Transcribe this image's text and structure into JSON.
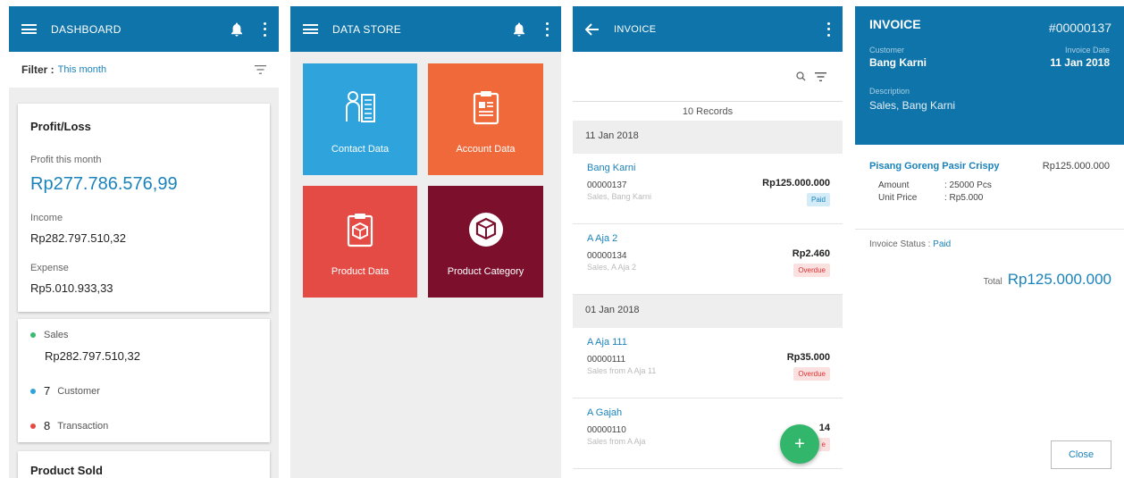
{
  "dashboard": {
    "title": "DASHBOARD",
    "filter_label": "Filter :",
    "filter_value": "This month",
    "profit_card_title": "Profit/Loss",
    "profit_label": "Profit this month",
    "profit_value": "Rp277.786.576,99",
    "income_label": "Income",
    "income_value": "Rp282.797.510,32",
    "expense_label": "Expense",
    "expense_value": "Rp5.010.933,33",
    "sales_label": "Sales",
    "sales_value": "Rp282.797.510,32",
    "customer_count": "7",
    "customer_label": "Customer",
    "transaction_count": "8",
    "transaction_label": "Transaction",
    "product_sold_title": "Product Sold"
  },
  "datastore": {
    "title": "DATA STORE",
    "tiles": [
      {
        "label": "Contact Data",
        "color": "#2ea3dc"
      },
      {
        "label": "Account Data",
        "color": "#f0693a"
      },
      {
        "label": "Product Data",
        "color": "#e54b45"
      },
      {
        "label": "Product Category",
        "color": "#7c0f2c"
      }
    ]
  },
  "invoice_list": {
    "title": "INVOICE",
    "records": "10 Records",
    "groups": [
      {
        "date": "11 Jan 2018",
        "items": [
          {
            "name": "Bang Karni",
            "number": "00000137",
            "desc": "Sales, Bang Karni",
            "amount": "Rp125.000.000",
            "status": "Paid"
          },
          {
            "name": "A Aja 2",
            "number": "00000134",
            "desc": "Sales, A Aja 2",
            "amount": "Rp2.460",
            "status": "Overdue"
          }
        ]
      },
      {
        "date": "01 Jan 2018",
        "items": [
          {
            "name": "A Aja 111",
            "number": "00000111",
            "desc": "Sales from A Aja 11",
            "amount": "Rp35.000",
            "status": "Overdue"
          },
          {
            "name": "A Gajah",
            "number": "00000110",
            "desc": "Sales from A Aja",
            "amount": "14",
            "status": "e"
          }
        ]
      }
    ],
    "fab": "+"
  },
  "invoice_detail": {
    "title": "INVOICE",
    "number": "#00000137",
    "customer_label": "Customer",
    "customer": "Bang Karni",
    "date_label": "Invoice Date",
    "date": "11 Jan 2018",
    "desc_label": "Description",
    "desc": "Sales, Bang Karni",
    "item_name": "Pisang Goreng Pasir Crispy",
    "item_price": "Rp125.000.000",
    "amount_label": "Amount",
    "amount_value": ": 25000 Pcs",
    "unit_label": "Unit Price",
    "unit_value": ": Rp5.000",
    "status_label": "Invoice Status :",
    "status_value": "Paid",
    "total_label": "Total",
    "total_value": "Rp125.000.000",
    "close_label": "Close"
  },
  "colors": {
    "primary": "#0f74aa",
    "accent": "#1a83bb",
    "fab": "#32b66c"
  }
}
